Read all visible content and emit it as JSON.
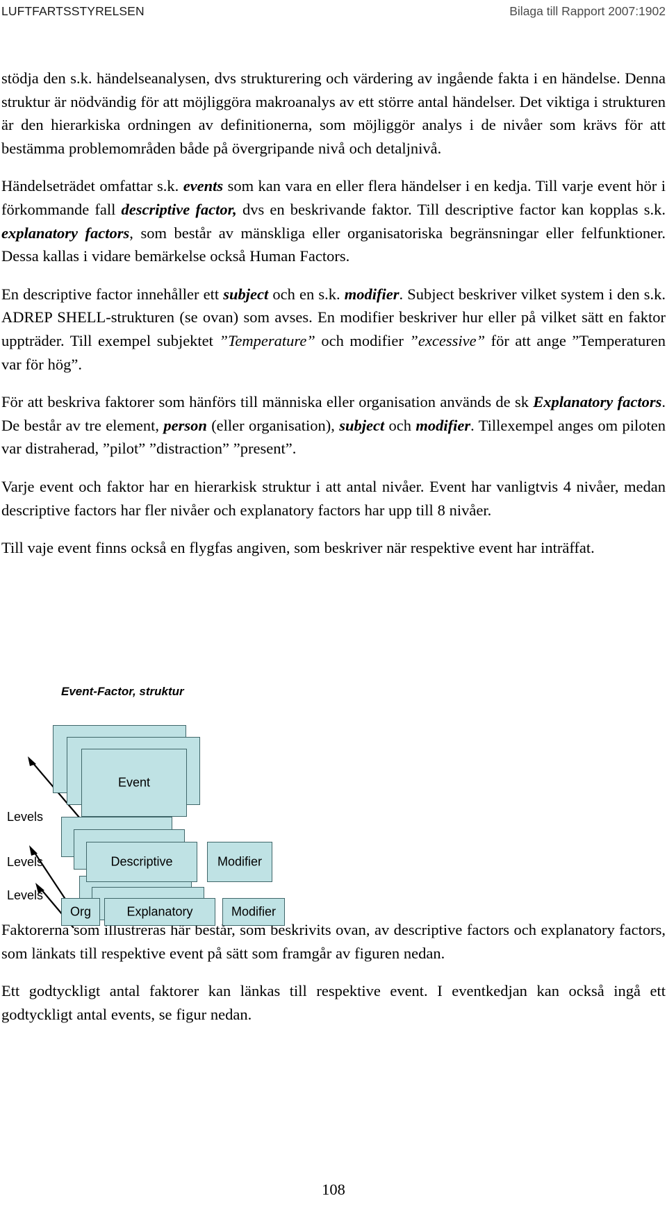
{
  "header": {
    "left": "LUFTFARTSSTYRELSEN",
    "right": "Bilaga till Rapport 2007:1902"
  },
  "body": {
    "paragraphs": [
      {
        "id": "p1",
        "runs": [
          {
            "style": "normal",
            "text": "stödja den s.k. händelseanalysen, dvs strukturering och värdering av ingående fakta i en händelse. Denna struktur är nödvändig för att möjliggöra makroanalys av ett större antal händelser. Det viktiga i strukturen är den hierarkiska ordningen av definitionerna, som möjliggör analys i de nivåer som krävs för att bestämma problemområden både på övergripande nivå och detaljnivå."
          }
        ]
      },
      {
        "id": "p2",
        "runs": [
          {
            "style": "normal",
            "text": "Händelseträdet omfattar s.k. "
          },
          {
            "style": "bold-italic",
            "text": "events"
          },
          {
            "style": "normal",
            "text": " som kan vara en eller flera händelser i en kedja. Till varje event hör i förkommande fall "
          },
          {
            "style": "bold-italic",
            "text": "descriptive factor,"
          },
          {
            "style": "normal",
            "text": " dvs en beskrivande faktor. Till descriptive factor kan kopplas s.k. "
          },
          {
            "style": "bold-italic",
            "text": "explanatory factors"
          },
          {
            "style": "normal",
            "text": ", som består av mänskliga eller organisatoriska begränsningar eller felfunktioner. Dessa kallas i vidare bemärkelse också Human Factors."
          }
        ]
      },
      {
        "id": "p3",
        "runs": [
          {
            "style": "normal",
            "text": "En descriptive factor innehåller ett "
          },
          {
            "style": "bold-italic",
            "text": "subject"
          },
          {
            "style": "normal",
            "text": " och en s.k. "
          },
          {
            "style": "bold-italic",
            "text": "modifier"
          },
          {
            "style": "normal",
            "text": ". Subject beskriver vilket system i den s.k. ADREP SHELL-strukturen (se ovan) som avses. En modifier beskriver hur eller på vilket sätt en faktor uppträder. Till exempel subjektet "
          },
          {
            "style": "italic",
            "text": "”Temperature”"
          },
          {
            "style": "normal",
            "text": " och modifier "
          },
          {
            "style": "italic",
            "text": "”excessive”"
          },
          {
            "style": "normal",
            "text": " för att ange ”Temperaturen var för hög”."
          }
        ]
      },
      {
        "id": "p4",
        "runs": [
          {
            "style": "normal",
            "text": "För att beskriva faktorer som hänförs till människa eller organisation används de sk "
          },
          {
            "style": "bold-italic",
            "text": "Explanatory factors"
          },
          {
            "style": "normal",
            "text": ". De består av tre element, "
          },
          {
            "style": "bold-italic",
            "text": "person"
          },
          {
            "style": "normal",
            "text": " (eller organisation), "
          },
          {
            "style": "bold-italic",
            "text": "subject"
          },
          {
            "style": "normal",
            "text": " och "
          },
          {
            "style": "bold-italic",
            "text": "modifier"
          },
          {
            "style": "normal",
            "text": ". Tillexempel anges om piloten var distraherad, ”pilot” ”distraction” ”present”."
          }
        ]
      },
      {
        "id": "p5",
        "runs": [
          {
            "style": "normal",
            "text": "Varje event och faktor har en hierarkisk struktur i att antal nivåer. Event har vanligtvis 4 nivåer, medan descriptive factors har fler nivåer och explanatory factors har upp till 8 nivåer."
          }
        ]
      },
      {
        "id": "p6",
        "runs": [
          {
            "style": "normal",
            "text": "Till vaje event finns också en flygfas angiven, som beskriver när respektive event har inträffat."
          }
        ]
      },
      {
        "id": "p7",
        "runs": [
          {
            "style": "normal",
            "text": "Faktorerna som illustreras här består, som beskrivits ovan, av descriptive factors och explanatory factors, som länkats till respektive event på sätt som framgår av figuren nedan."
          }
        ]
      },
      {
        "id": "p8",
        "runs": [
          {
            "style": "normal",
            "text": "Ett godtyckligt antal faktorer kan länkas till respektive event. I eventkedjan kan också ingå ett godtyckligt antal events, se figur nedan."
          }
        ]
      }
    ]
  },
  "figure": {
    "caption": "Event-Factor, struktur",
    "colors": {
      "card_fill": "#bfe2e4",
      "card_border": "#3f6669",
      "text": "#000000"
    },
    "levels_labels": [
      {
        "id": "levels-event",
        "text": "Levels"
      },
      {
        "id": "levels-descriptive",
        "text": "Levels"
      },
      {
        "id": "levels-explanatory",
        "text": "Levels"
      }
    ],
    "rows": [
      {
        "id": "row-event",
        "cards": [
          {
            "id": "event-card",
            "label": "Event",
            "stack": 3
          }
        ]
      },
      {
        "id": "row-descriptive",
        "cards": [
          {
            "id": "descriptive-card",
            "label": "Descriptive",
            "stack": 3
          },
          {
            "id": "descriptive-modifier-card",
            "label": "Modifier",
            "stack": 1
          }
        ]
      },
      {
        "id": "row-explanatory",
        "cards": [
          {
            "id": "org-card",
            "label": "Org",
            "stack": 1
          },
          {
            "id": "explanatory-card",
            "label": "Explanatory",
            "stack": 3
          },
          {
            "id": "explanatory-modifier-card",
            "label": "Modifier",
            "stack": 1
          }
        ]
      }
    ]
  },
  "footer": {
    "page_number": "108"
  }
}
